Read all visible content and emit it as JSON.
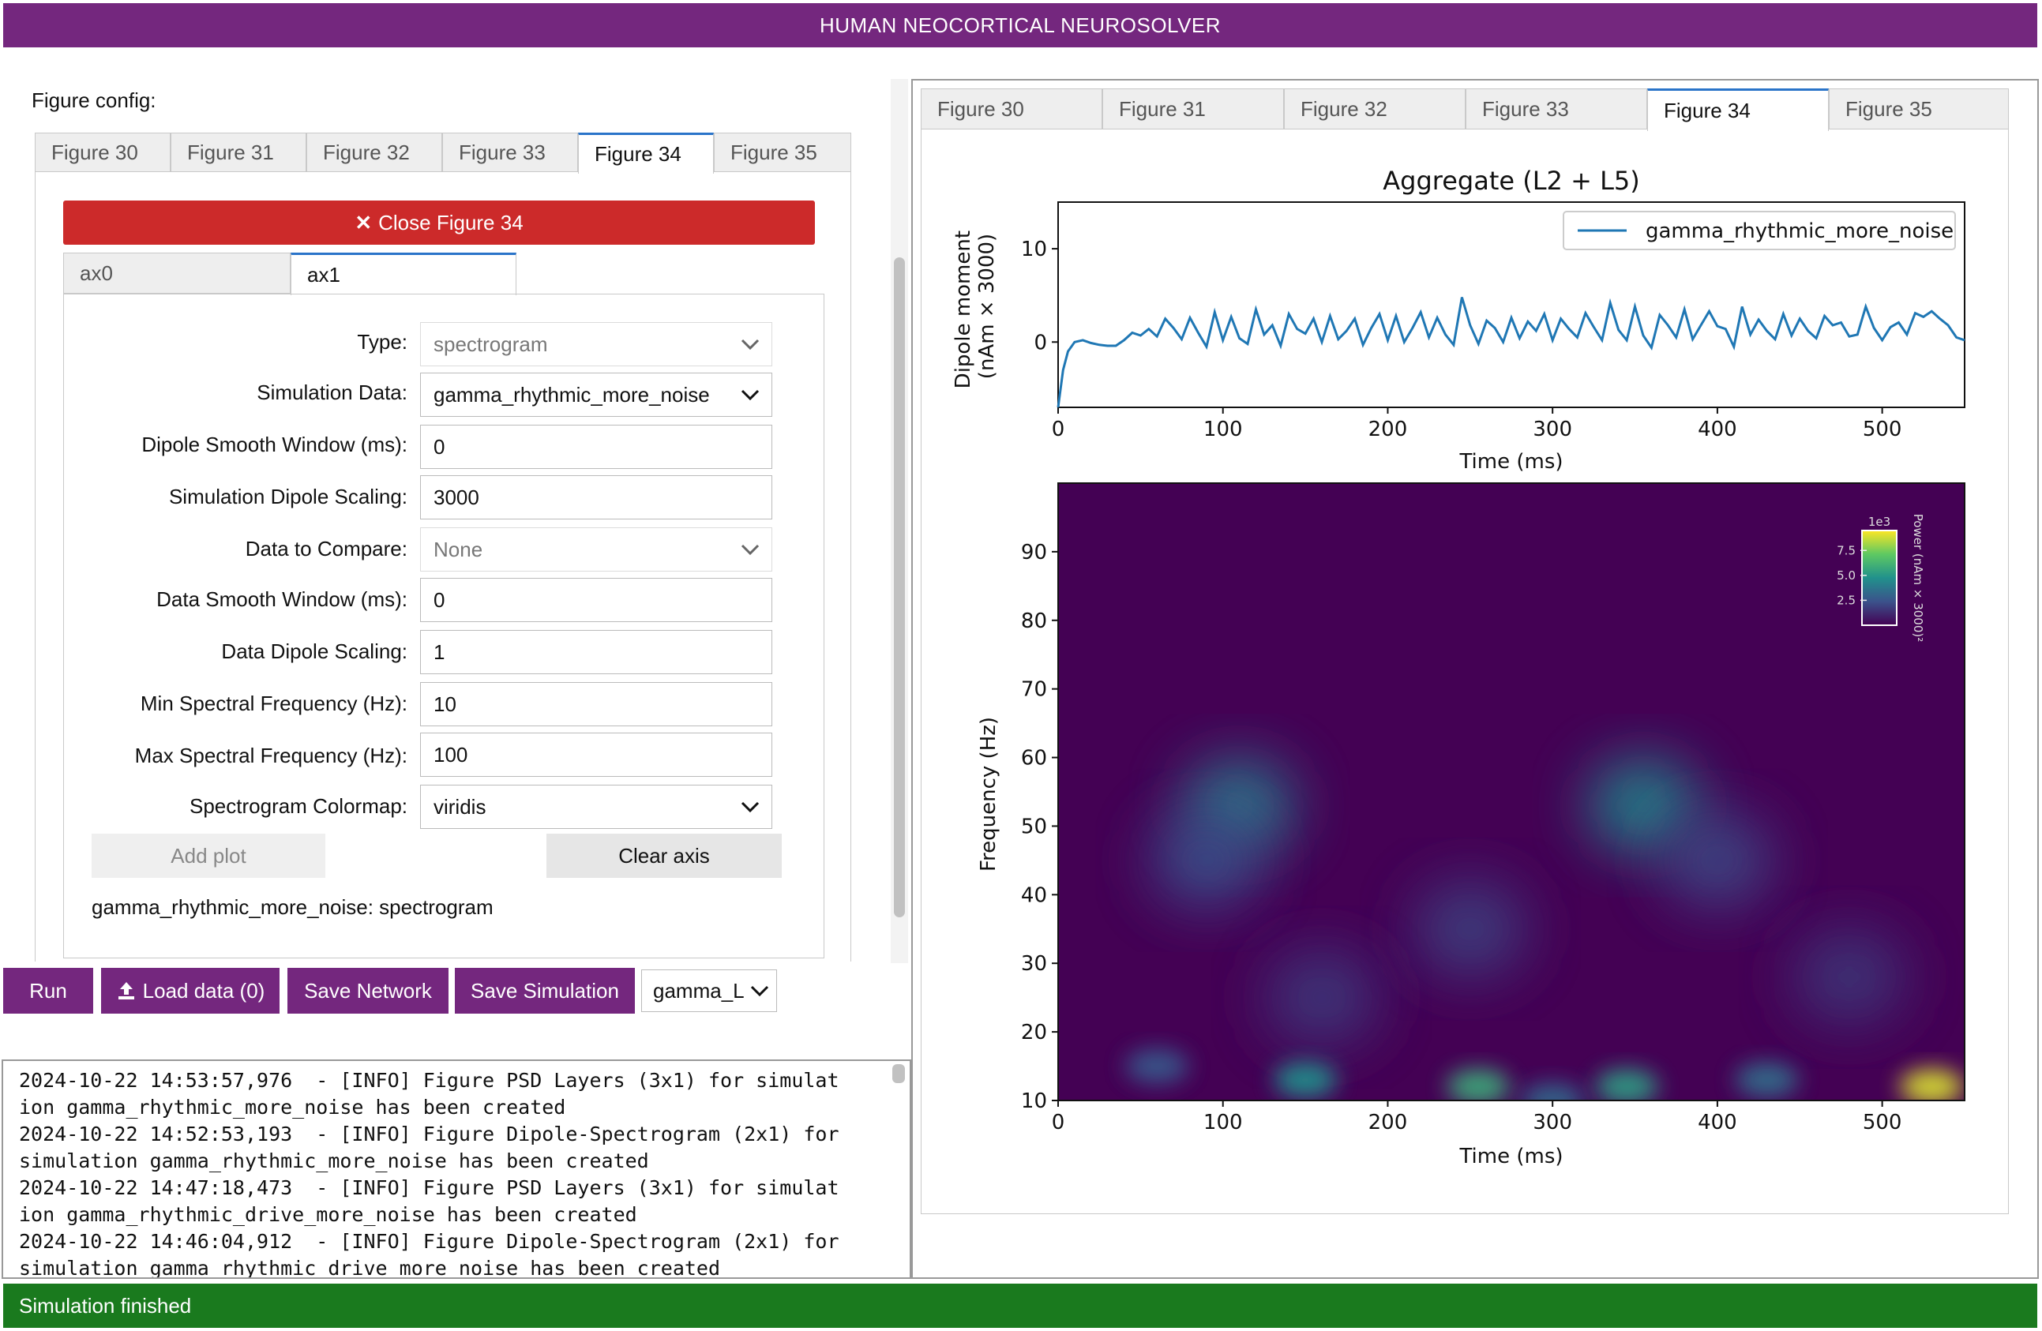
{
  "app": {
    "title": "HUMAN NEOCORTICAL NEUROSOLVER"
  },
  "left_panel": {
    "heading": "Figure config:",
    "figure_tabs": [
      "Figure 30",
      "Figure 31",
      "Figure 32",
      "Figure 33",
      "Figure 34",
      "Figure 35"
    ],
    "active_figure_tab": "Figure 34",
    "close_button": "Close Figure 34",
    "axis_tabs": [
      "ax0",
      "ax1"
    ],
    "active_axis_tab": "ax1",
    "form": {
      "type": {
        "label": "Type:",
        "value": "spectrogram"
      },
      "simulation_data": {
        "label": "Simulation Data:",
        "value": "gamma_rhythmic_more_noise"
      },
      "dipole_smooth_window": {
        "label": "Dipole Smooth Window (ms):",
        "value": "0"
      },
      "simulation_dipole_scaling": {
        "label": "Simulation Dipole Scaling:",
        "value": "3000"
      },
      "data_to_compare": {
        "label": "Data to Compare:",
        "value": "None"
      },
      "data_smooth_window": {
        "label": "Data Smooth Window (ms):",
        "value": "0"
      },
      "data_dipole_scaling": {
        "label": "Data Dipole Scaling:",
        "value": "1"
      },
      "min_spectral_freq": {
        "label": "Min Spectral Frequency (Hz):",
        "value": "10"
      },
      "max_spectral_freq": {
        "label": "Max Spectral Frequency (Hz):",
        "value": "100"
      },
      "spectrogram_colormap": {
        "label": "Spectrogram Colormap:",
        "value": "viridis"
      }
    },
    "add_plot": "Add plot",
    "clear_axis": "Clear axis",
    "plot_summary": "gamma_rhythmic_more_noise: spectrogram"
  },
  "toolbar": {
    "run": "Run",
    "load_data": "Load data (0)",
    "save_network": "Save Network",
    "save_simulation": "Save Simulation",
    "sim_select": "gamma_L"
  },
  "log": {
    "lines": [
      "2024-10-22 14:53:57,976  - [INFO] Figure PSD Layers (3x1) for simulat",
      "ion gamma_rhythmic_more_noise has been created",
      "2024-10-22 14:52:53,193  - [INFO] Figure Dipole-Spectrogram (2x1) for",
      "simulation gamma_rhythmic_more_noise has been created",
      "2024-10-22 14:47:18,473  - [INFO] Figure PSD Layers (3x1) for simulat",
      "ion gamma_rhythmic_drive_more_noise has been created",
      "2024-10-22 14:46:04,912  - [INFO] Figure Dipole-Spectrogram (2x1) for",
      "simulation gamma_rhythmic_drive_more_noise has been created"
    ]
  },
  "right_panel": {
    "figure_tabs": [
      "Figure 30",
      "Figure 31",
      "Figure 32",
      "Figure 33",
      "Figure 34",
      "Figure 35"
    ],
    "active_figure_tab": "Figure 34"
  },
  "status": {
    "text": "Simulation finished"
  },
  "colors": {
    "brand": "#74277e",
    "close_red": "#cc2a2a",
    "status_green": "#1a7a1e",
    "tab_accent": "#2a74c9",
    "line_blue": "#1f77b4"
  },
  "chart_data": [
    {
      "type": "line",
      "title": "Aggregate (L2 + L5)",
      "xlabel": "Time (ms)",
      "ylabel": "Dipole moment\n(nAm × 3000)",
      "xlim": [
        0,
        550
      ],
      "ylim": [
        -7,
        15
      ],
      "xticks": [
        0,
        100,
        200,
        300,
        400,
        500
      ],
      "yticks": [
        0,
        10
      ],
      "legend": {
        "entries": [
          "gamma_rhythmic_more_noise"
        ],
        "position": "top-right"
      },
      "series": [
        {
          "name": "gamma_rhythmic_more_noise",
          "x": [
            0,
            3,
            6,
            10,
            15,
            20,
            25,
            30,
            35,
            40,
            45,
            50,
            55,
            60,
            65,
            70,
            75,
            80,
            85,
            90,
            95,
            100,
            105,
            110,
            115,
            120,
            125,
            130,
            135,
            140,
            145,
            150,
            155,
            160,
            165,
            170,
            175,
            180,
            185,
            190,
            195,
            200,
            205,
            210,
            215,
            220,
            225,
            230,
            235,
            240,
            245,
            250,
            255,
            260,
            265,
            270,
            275,
            280,
            285,
            290,
            295,
            300,
            305,
            310,
            315,
            320,
            325,
            330,
            335,
            340,
            345,
            350,
            355,
            360,
            365,
            370,
            375,
            380,
            385,
            390,
            395,
            400,
            405,
            410,
            415,
            420,
            425,
            430,
            435,
            440,
            445,
            450,
            455,
            460,
            465,
            470,
            475,
            480,
            485,
            490,
            495,
            500,
            505,
            510,
            515,
            520,
            525,
            530,
            535,
            540,
            545,
            550
          ],
          "y": [
            -7,
            -3,
            -1,
            0,
            0.2,
            -0.1,
            -0.3,
            -0.4,
            -0.4,
            0.2,
            1,
            0.7,
            1.4,
            0.6,
            2.5,
            1.5,
            0.3,
            2.6,
            1,
            -0.5,
            3.2,
            0.2,
            2.7,
            0.4,
            -0.2,
            3.5,
            0.8,
            1.8,
            -0.4,
            3,
            1.4,
            0.9,
            2.5,
            0,
            2.8,
            0.3,
            1.2,
            2.5,
            -0.3,
            1.5,
            3,
            0.2,
            2.8,
            0,
            1.5,
            3.2,
            0.5,
            2.6,
            0.8,
            -0.3,
            4.8,
            1.8,
            -0.2,
            2.3,
            1.5,
            0,
            2.6,
            0.4,
            2.2,
            1.2,
            3,
            0.2,
            2.5,
            1.4,
            0.5,
            3.1,
            1.6,
            0.2,
            4.2,
            1.3,
            0.2,
            3.8,
            0.7,
            -0.6,
            2.9,
            1.8,
            0.5,
            3.5,
            0.3,
            1.8,
            3.3,
            1.7,
            1.4,
            -0.5,
            3.8,
            0.8,
            2.4,
            1.2,
            0.3,
            3,
            0.7,
            2.5,
            1.2,
            0.4,
            2.8,
            1.8,
            2.1,
            0.6,
            0.8,
            3.8,
            1.5,
            0.2,
            1.6,
            2.1,
            0.8,
            3.1,
            2.7,
            3.3,
            2.5,
            1.8,
            0.5,
            0.2
          ]
        }
      ]
    },
    {
      "type": "heatmap",
      "xlabel": "Time (ms)",
      "ylabel": "Frequency (Hz)",
      "xlim": [
        0,
        550
      ],
      "ylim": [
        10,
        100
      ],
      "xticks": [
        0,
        100,
        200,
        300,
        400,
        500
      ],
      "yticks": [
        10,
        20,
        30,
        40,
        50,
        60,
        70,
        80,
        90
      ],
      "colormap": "viridis",
      "colorbar": {
        "label": "Power (nAm × 3000)²",
        "exponent_label": "1e3",
        "ticks": [
          2.5,
          5.0,
          7.5
        ],
        "position": "top-right"
      },
      "blobs": [
        {
          "t": 110,
          "f": 53,
          "power": 3.8
        },
        {
          "t": 355,
          "f": 53,
          "power": 4.2
        },
        {
          "t": 90,
          "f": 45,
          "power": 2.2
        },
        {
          "t": 400,
          "f": 45,
          "power": 2.0
        },
        {
          "t": 250,
          "f": 35,
          "power": 1.8
        },
        {
          "t": 160,
          "f": 25,
          "power": 1.6
        },
        {
          "t": 480,
          "f": 28,
          "power": 1.5
        },
        {
          "t": 60,
          "f": 15,
          "power": 2.5
        },
        {
          "t": 150,
          "f": 13,
          "power": 4.5
        },
        {
          "t": 255,
          "f": 12,
          "power": 5.5
        },
        {
          "t": 345,
          "f": 12,
          "power": 5.0
        },
        {
          "t": 430,
          "f": 13,
          "power": 3.2
        },
        {
          "t": 530,
          "f": 12,
          "power": 8.5
        },
        {
          "t": 300,
          "f": 10,
          "power": 3.0
        }
      ]
    }
  ]
}
